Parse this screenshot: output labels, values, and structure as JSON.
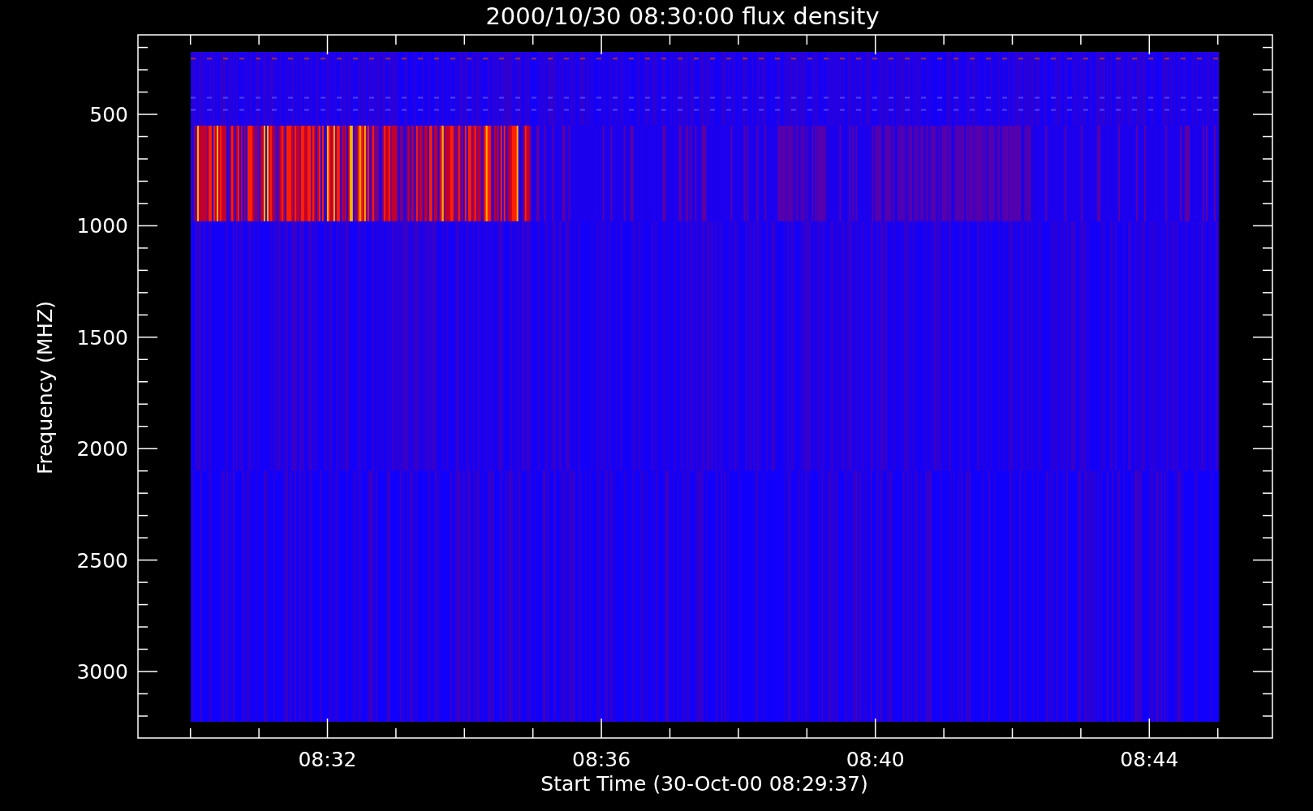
{
  "plot": {
    "title": "2000/10/30 08:30:00 flux density",
    "xlabel": "Start Time (30-Oct-00 08:29:37)",
    "ylabel": "Frequency (MHZ)",
    "yticks": [
      "500",
      "1000",
      "1500",
      "2000",
      "2500",
      "3000"
    ],
    "xticks": [
      "08:32",
      "08:36",
      "08:40",
      "08:44"
    ]
  }
}
